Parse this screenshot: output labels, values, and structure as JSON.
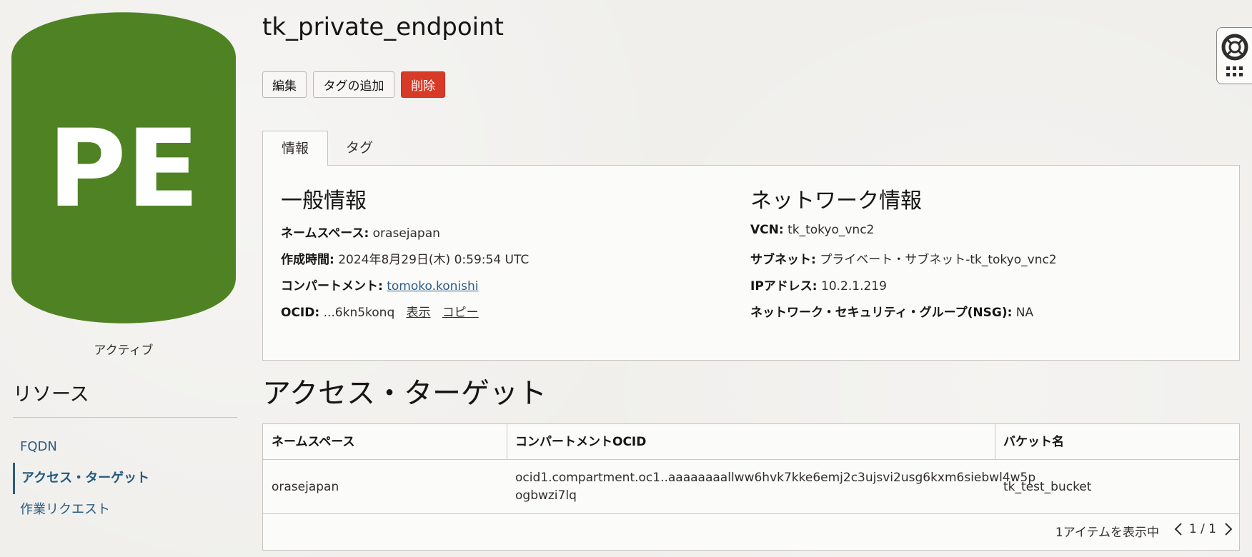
{
  "badge": {
    "initials": "PE",
    "color": "#4f8223"
  },
  "status": "アクティブ",
  "resources": {
    "title": "リソース",
    "items": [
      {
        "label": "FQDN",
        "active": false
      },
      {
        "label": "アクセス・ターゲット",
        "active": true
      },
      {
        "label": "作業リクエスト",
        "active": false
      }
    ]
  },
  "header": {
    "title": "tk_private_endpoint",
    "buttons": {
      "edit": "編集",
      "add_tags": "タグの追加",
      "delete": "削除"
    }
  },
  "tabs": [
    {
      "label": "情報",
      "active": true
    },
    {
      "label": "タグ",
      "active": false
    }
  ],
  "general": {
    "title": "一般情報",
    "namespace_label": "ネームスペース:",
    "namespace_value": "orasejapan",
    "created_label": "作成時間:",
    "created_value": "2024年8月29日(木) 0:59:54 UTC",
    "compartment_label": "コンパートメント:",
    "compartment_value": "tomoko.konishi",
    "ocid_label": "OCID:",
    "ocid_value": "...6kn5konq",
    "ocid_show": "表示",
    "ocid_copy": "コピー"
  },
  "network": {
    "title": "ネットワーク情報",
    "vcn_label": "VCN:",
    "vcn_value": "tk_tokyo_vnc2",
    "subnet_label": "サブネット:",
    "subnet_value": "プライベート・サブネット-tk_tokyo_vnc2",
    "ip_label": "IPアドレス:",
    "ip_value": "10.2.1.219",
    "nsg_label": "ネットワーク・セキュリティ・グループ(NSG):",
    "nsg_value": "NA"
  },
  "access_targets": {
    "title": "アクセス・ターゲット",
    "columns": [
      "ネームスペース",
      "コンパートメントOCID",
      "バケット名"
    ],
    "rows": [
      {
        "namespace": "orasejapan",
        "compartment_ocid_line1": "ocid1.compartment.oc1..aaaaaaaallww6hvk7kke6emj2c3ujsvi2usg6kxm6siebwl4w5p",
        "compartment_ocid_line2": "ogbwzi7lq",
        "bucket": "tk_test_bucket"
      }
    ],
    "pager_text": "1アイテムを表示中",
    "pager_count": "1 / 1"
  },
  "icons": {
    "prev": "chevron-left-icon",
    "next": "chevron-right-icon",
    "help": "lifebuoy-icon",
    "apps": "grid-icon"
  }
}
